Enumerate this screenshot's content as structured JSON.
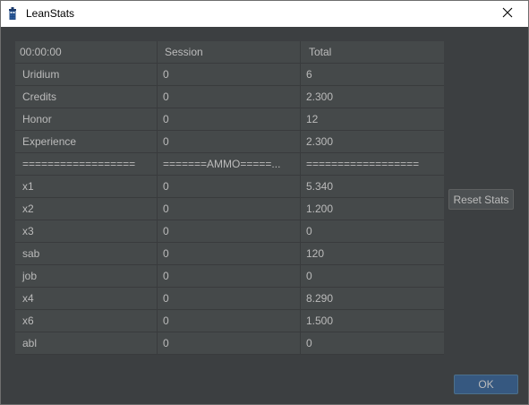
{
  "window": {
    "title": "LeanStats",
    "icon": "tardis-icon",
    "close_icon": "close-icon"
  },
  "table": {
    "headers": [
      "00:00:00",
      "Session",
      "Total"
    ],
    "rows": [
      [
        "Uridium",
        "0",
        "6"
      ],
      [
        "Credits",
        "0",
        "2.300"
      ],
      [
        "Honor",
        "0",
        "12"
      ],
      [
        "Experience",
        "0",
        "2.300"
      ],
      [
        "==================",
        "=======AMMO=====...",
        "=================="
      ],
      [
        "x1",
        "0",
        "5.340"
      ],
      [
        "x2",
        "0",
        "1.200"
      ],
      [
        "x3",
        "0",
        "0"
      ],
      [
        "sab",
        "0",
        "120"
      ],
      [
        "job",
        "0",
        "0"
      ],
      [
        "x4",
        "0",
        "8.290"
      ],
      [
        "x6",
        "0",
        "1.500"
      ],
      [
        "abl",
        "0",
        "0"
      ]
    ]
  },
  "buttons": {
    "reset_label": "Reset Stats",
    "ok_label": "OK"
  },
  "colors": {
    "background": "#3c3f41",
    "table_background": "#45494a",
    "text": "#bbbbbb",
    "ok_button": "#365880"
  }
}
